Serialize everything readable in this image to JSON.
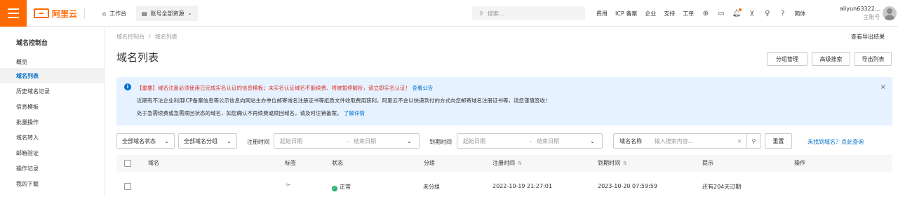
{
  "topbar": {
    "logo_text": "阿里云",
    "workbench": "工作台",
    "resources": "账号全部资源",
    "search_placeholder": "搜索...",
    "links": [
      "费用",
      "ICP 备案",
      "企业",
      "支持",
      "工单"
    ],
    "lang": "简体",
    "user_name": "aliyun63322...",
    "user_role": "主账号",
    "icons": [
      "menu-icon",
      "home-icon",
      "resources-icon",
      "search-icon",
      "cloud-shell-icon",
      "terminal-icon",
      "bell-icon",
      "cart-icon",
      "lightbulb-icon",
      "help-icon"
    ]
  },
  "sidebar": {
    "title": "域名控制台",
    "items": [
      {
        "label": "概览"
      },
      {
        "label": "域名列表",
        "active": true
      },
      {
        "label": "历史域名记录"
      },
      {
        "label": "信息模板"
      },
      {
        "label": "批量操作"
      },
      {
        "label": "域名转入"
      },
      {
        "label": "邮箱验证"
      },
      {
        "label": "操作记录"
      },
      {
        "label": "我的下载"
      }
    ]
  },
  "main": {
    "breadcrumb": [
      "域名控制台",
      "域名列表"
    ],
    "breadcrumb_sep": "/",
    "export_results": "查看导出结果",
    "title": "域名列表",
    "actions": [
      "分组管理",
      "高级搜索",
      "导出列表"
    ],
    "notice": {
      "line1_prefix": "【重要】域名注册必须使用已完成实名认证的信息模板；未实名认证域名不能续费、将被暂停解析，请立即实名认证！",
      "line1_link": "查看公告",
      "line2": "近期有不法企业利用ICP备案信息等公示信息向网站主办单位邮寄域名注册证书等纸质文件收取费用获利，阿里云不会以快递到付的方式向您邮寄域名注册证书等，请您谨慎签收！",
      "line3_prefix": "处于急需续费或急需赎回状态的域名，如您确认不再续费或赎回域名，请及时注销备案。",
      "line3_link": "了解详情"
    },
    "filters": {
      "status_select": "全部域名状态",
      "group_select": "全部域名分组",
      "reg_time_label": "注册时间",
      "reg_start": "起始日期",
      "reg_end": "结束日期",
      "range_sep": "-",
      "exp_time_label": "到期时间",
      "exp_start": "起始日期",
      "exp_end": "结束日期",
      "name_label": "域名名称",
      "name_placeholder": "输入搜索内容...",
      "reset": "重置",
      "not_found_link": "未找到域名？点此查询"
    },
    "table": {
      "columns": [
        "域名",
        "标签",
        "状态",
        "分组",
        "注册时间",
        "到期时间",
        "提示",
        "操作"
      ],
      "rows": [
        {
          "status": "正常",
          "group": "未分组",
          "reg_time": "2022-10-19 21:27:01",
          "exp_time": "2023-10-20 07:59:59",
          "tip": "还有204天过期"
        }
      ]
    }
  },
  "colors": {
    "brand": "#ff6a00",
    "link": "#0070cc",
    "notice_bg": "#e6f2ff",
    "danger": "#d93026",
    "success": "#23b066"
  }
}
